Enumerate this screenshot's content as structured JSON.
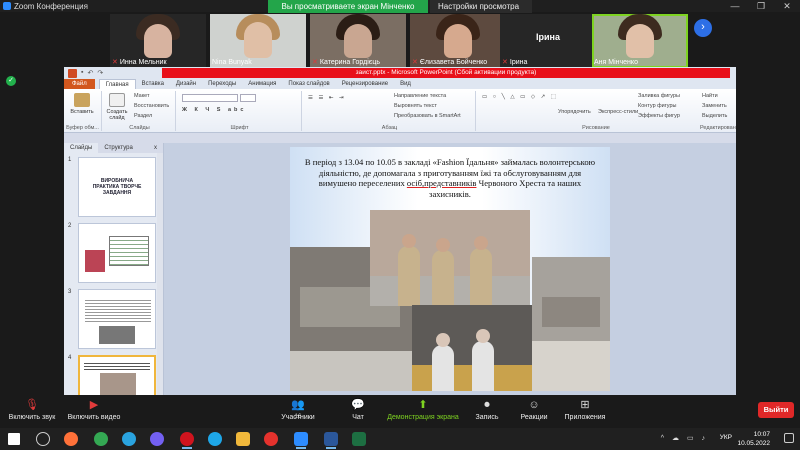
{
  "zoom": {
    "window_title": "Zoom Конференция",
    "share_banner": "Вы просматриваете экран Мінченко Анна",
    "view_options": "Настройки просмотра",
    "view_options_caret": "⌄",
    "window_controls": [
      "—",
      "❐",
      "✕"
    ]
  },
  "participants": [
    {
      "name": "Инна Мельник",
      "muted": true,
      "has_video": true
    },
    {
      "name": "Nina Bunyak",
      "muted": false,
      "has_video": true
    },
    {
      "name": "Катерина Гордієць",
      "muted": true,
      "has_video": true
    },
    {
      "name": "Єлизавета Бойченко",
      "muted": true,
      "has_video": true
    },
    {
      "name": "Ірина",
      "center_name": "Ірина",
      "muted": true,
      "has_video": false
    },
    {
      "name": "Аня Мінченко",
      "muted": false,
      "has_video": true,
      "active": true
    }
  ],
  "ppt": {
    "title": "заист.pptx - Microsoft PowerPoint (Сбой активации продукта)",
    "menu": [
      "Файл",
      "Главная",
      "Вставка",
      "Дизайн",
      "Переходы",
      "Анимация",
      "Показ слайдов",
      "Рецензирование",
      "Вид"
    ],
    "ribbon": {
      "paste": "Вставить",
      "create": "Создать слайд",
      "layout": "Макет",
      "reset": "Восстановить",
      "section": "Раздел",
      "clipboard_group": "Буфер обм...",
      "slides_group": "Слайды",
      "font_group": "Шрифт",
      "paragraph_group": "Абзац",
      "text_dir": "Направление текста",
      "align_text": "Выровнять текст",
      "smartart": "Преобразовать в SmartArt",
      "drawing_group": "Рисование",
      "arrange": "Упорядочить",
      "quick_styles": "Экспресс-стили",
      "fill": "Заливка фигуры",
      "outline": "Контур фигуры",
      "effects": "Эффекты фигур",
      "find": "Найти",
      "replace": "Заменить",
      "select": "Выделить",
      "editing_group": "Редактирование"
    },
    "pane_tabs": [
      "Слайды",
      "Структура"
    ],
    "pane_close": "x",
    "thumbnails": [
      {
        "num": "1",
        "title": "ВИРОБНИЧА ПРАКТИКА ТВОРЧЕ ЗАВДАННЯ"
      },
      {
        "num": "2"
      },
      {
        "num": "3"
      },
      {
        "num": "4"
      }
    ],
    "slide_text_before": "В період з 13.04 по 10.05 в закладі «Fashion Їдальня» займалась волонтерською діяльністю,  де допомагала з приготуванням їжі  та обслуговуванням для вимушено переселених ",
    "slide_text_underlined": "осіб,представників",
    "slide_text_after": " Червоного Хреста та наших захисників."
  },
  "toolbar": {
    "mute": "Включить звук",
    "video": "Включить видео",
    "participants": "Участники",
    "participants_count": "16",
    "chat": "Чат",
    "share": "Демонстрация экрана",
    "record": "Запись",
    "reactions": "Реакции",
    "apps": "Приложения",
    "leave": "Выйти"
  },
  "taskbar": {
    "time": "10:07",
    "date": "10.05.2022",
    "lang": "УКР",
    "tray_icons": "^ ☁ ▭ ♪"
  },
  "colors": {
    "zoom_green": "#23a54a",
    "leave_red": "#e02828",
    "ppt_file": "#d2571e",
    "activation_red": "#e8101a"
  }
}
